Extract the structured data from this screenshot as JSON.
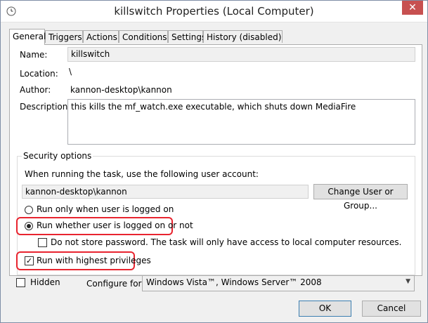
{
  "window": {
    "title": "killswitch Properties (Local Computer)",
    "close_glyph": "✕"
  },
  "tabs": [
    {
      "label": "General"
    },
    {
      "label": "Triggers"
    },
    {
      "label": "Actions"
    },
    {
      "label": "Conditions"
    },
    {
      "label": "Settings"
    },
    {
      "label": "History (disabled)"
    }
  ],
  "general": {
    "name_label": "Name:",
    "name_value": "killswitch",
    "location_label": "Location:",
    "location_value": "\\",
    "author_label": "Author:",
    "author_value": "kannon-desktop\\kannon",
    "description_label": "Description:",
    "description_value": "this kills the mf_watch.exe executable, which shuts down MediaFire"
  },
  "security": {
    "group_title": "Security options",
    "account_prompt": "When running the task, use the following user account:",
    "account_value": "kannon-desktop\\kannon",
    "change_button": "Change User or Group...",
    "radio_logged_on": "Run only when user is logged on",
    "radio_whether": "Run whether user is logged on or not",
    "radio_selected": "whether",
    "store_password_label": "Do not store password.  The task will only have access to local computer resources.",
    "store_password_checked": false,
    "highest_privileges_label": "Run with highest privileges",
    "highest_privileges_checked": true
  },
  "bottom": {
    "hidden_label": "Hidden",
    "hidden_checked": false,
    "configure_label": "Configure for:",
    "configure_value": "Windows Vista™, Windows Server™ 2008"
  },
  "buttons": {
    "ok": "OK",
    "cancel": "Cancel"
  },
  "colors": {
    "highlight": "#e8242f",
    "close_button": "#c75050"
  },
  "icons": {
    "title": "task-scheduler-clock-icon",
    "close": "close-icon",
    "dropdown": "chevron-down-icon",
    "check": "checkmark-icon"
  }
}
